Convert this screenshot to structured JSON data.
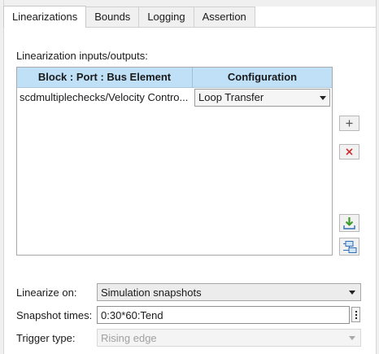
{
  "tabs": [
    {
      "label": "Linearizations",
      "active": true
    },
    {
      "label": "Bounds",
      "active": false
    },
    {
      "label": "Logging",
      "active": false
    },
    {
      "label": "Assertion",
      "active": false
    }
  ],
  "io_section": {
    "label": "Linearization inputs/outputs:",
    "columns": [
      "Block : Port : Bus Element",
      "Configuration"
    ],
    "rows": [
      {
        "block": "scdmultiplechecks/Velocity Contro...",
        "configuration": "Loop Transfer"
      }
    ]
  },
  "side_buttons": {
    "add_icon": "plus-icon",
    "delete_icon": "delete-x-icon",
    "import_icon": "import-arrow-icon",
    "select_icon": "highlight-blocks-icon"
  },
  "form": {
    "linearize_on_label": "Linearize on:",
    "linearize_on_value": "Simulation snapshots",
    "snapshot_times_label": "Snapshot times:",
    "snapshot_times_value": "0:30*60:Tend",
    "trigger_type_label": "Trigger type:",
    "trigger_type_value": "Rising edge"
  },
  "colors": {
    "header_bg": "#bfe0f7",
    "delete_red": "#d03030",
    "import_green": "#3a9a2a"
  }
}
